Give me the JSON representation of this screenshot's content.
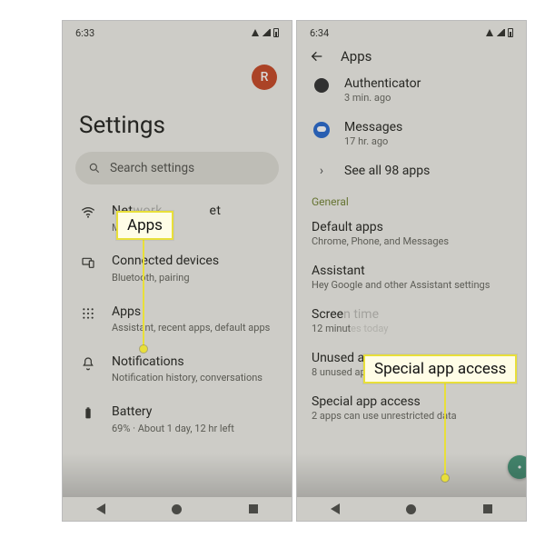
{
  "left": {
    "status_time": "6:33",
    "avatar_letter": "R",
    "title": "Settings",
    "search_placeholder": "Search settings",
    "items": [
      {
        "title": "Network & internet",
        "desc": "Mobile"
      },
      {
        "title": "Connected devices",
        "desc": "Bluetooth, pairing"
      },
      {
        "title": "Apps",
        "desc": "Assistant, recent apps, default apps"
      },
      {
        "title": "Notifications",
        "desc": "Notification history, conversations"
      },
      {
        "title": "Battery",
        "desc": "69% · About 1 day, 12 hr left"
      }
    ]
  },
  "right": {
    "status_time": "6:34",
    "header_title": "Apps",
    "recent": [
      {
        "title": "Authenticator",
        "desc": "3 min. ago"
      },
      {
        "title": "Messages",
        "desc": "17 hr. ago"
      }
    ],
    "see_all": "See all 98 apps",
    "section_label": "General",
    "general": [
      {
        "title": "Default apps",
        "desc": "Chrome, Phone, and Messages"
      },
      {
        "title": "Assistant",
        "desc": "Hey Google and other Assistant settings"
      },
      {
        "title": "Screen time",
        "desc": "12 minutes today"
      },
      {
        "title": "Unused apps",
        "desc": "8 unused apps"
      },
      {
        "title": "Special app access",
        "desc": "2 apps can use unrestricted data"
      }
    ]
  },
  "callouts": {
    "apps": "Apps",
    "special": "Special app access"
  }
}
